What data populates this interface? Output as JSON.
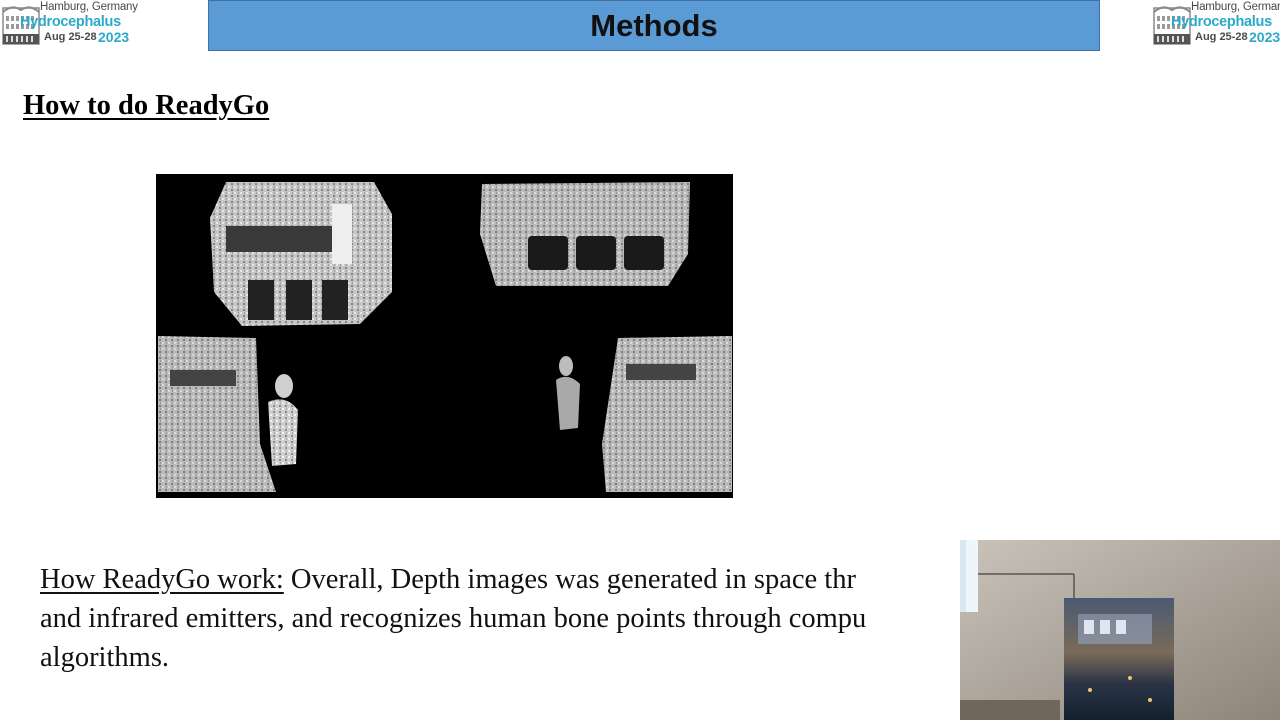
{
  "slide": {
    "title": "Methods",
    "subtitle": "How to do ReadyGo",
    "body_lead": "How ReadyGo  work:",
    "body_lines": [
      " Overall, Depth images was generated in space thr",
      "and infrared emitters, and recognizes human bone points through compu",
      "algorithms."
    ]
  },
  "logo": {
    "city": "Hamburg, Germany",
    "name": "Hydrocephalus",
    "dates": "Aug 25-28",
    "year": "2023"
  },
  "figure": {
    "icon": "depth-point-cloud-images"
  },
  "colors": {
    "title_bar": "#5b9bd5",
    "logo_accent": "#2aa9c9"
  }
}
